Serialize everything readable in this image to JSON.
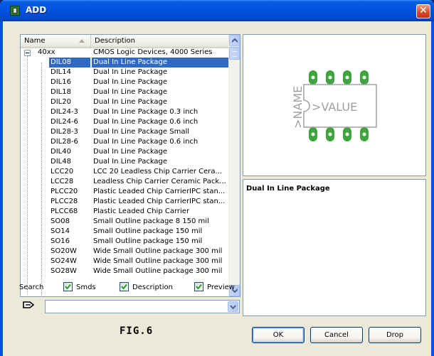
{
  "window": {
    "title": "ADD",
    "close_label": "✕"
  },
  "list": {
    "columns": {
      "name": "Name",
      "description": "Description"
    },
    "group": {
      "name": "40xx",
      "description": "CMOS Logic Devices, 4000 Series"
    },
    "rows": [
      {
        "name": "DIL08",
        "description": "Dual In Line Package",
        "selected": true
      },
      {
        "name": "DIL14",
        "description": "Dual In Line Package"
      },
      {
        "name": "DIL16",
        "description": "Dual In Line Package"
      },
      {
        "name": "DIL18",
        "description": "Dual In Line Package"
      },
      {
        "name": "DIL20",
        "description": "Dual In Line Package"
      },
      {
        "name": "DIL24-3",
        "description": "Dual In Line Package 0.3 inch"
      },
      {
        "name": "DIL24-6",
        "description": "Dual In Line Package 0.6 inch"
      },
      {
        "name": "DIL28-3",
        "description": "Dual In Line Package Small"
      },
      {
        "name": "DIL28-6",
        "description": "Dual In Line Package 0.6 inch"
      },
      {
        "name": "DIL40",
        "description": "Dual In Line Package"
      },
      {
        "name": "DIL48",
        "description": "Dual In Line Package"
      },
      {
        "name": "LCC20",
        "description": "LCC 20 Leadless Chip Carrier  Cera..."
      },
      {
        "name": "LCC28",
        "description": "Leadless Chip Carrier Ceramic Packa..."
      },
      {
        "name": "PLCC20",
        "description": "Plastic Leaded Chip CarrierIPC stan..."
      },
      {
        "name": "PLCC28",
        "description": "Plastic Leaded Chip CarrierIPC stan..."
      },
      {
        "name": "PLCC68",
        "description": "Plastic Leaded Chip Carrier"
      },
      {
        "name": "SO08",
        "description": "Small Outline package 8 150 mil"
      },
      {
        "name": "SO14",
        "description": "Small Outline package 150 mil"
      },
      {
        "name": "SO16",
        "description": "Small Outline package 150 mil"
      },
      {
        "name": "SO20W",
        "description": "Wide Small Outline package 300 mil"
      },
      {
        "name": "SO24W",
        "description": "Wide Small Outline package 300 mil"
      },
      {
        "name": "SO28W",
        "description": "Wide Small Outline package 300 mil"
      }
    ]
  },
  "preview": {
    "name_label": ">NAME",
    "value_label": ">VALUE",
    "pad_color": "#3fa33f"
  },
  "description_text": "Dual In Line Package",
  "search": {
    "label": "Search",
    "options": [
      {
        "label": "Smds",
        "checked": true
      },
      {
        "label": "Description",
        "checked": true
      },
      {
        "label": "Preview",
        "checked": true
      }
    ],
    "input_value": ""
  },
  "figure_label": "FIG.6",
  "buttons": {
    "ok": "OK",
    "cancel": "Cancel",
    "drop": "Drop"
  },
  "colors": {
    "title_bar": "#0054e3",
    "selection": "#316ac5",
    "dialog_bg": "#ece9d8"
  }
}
